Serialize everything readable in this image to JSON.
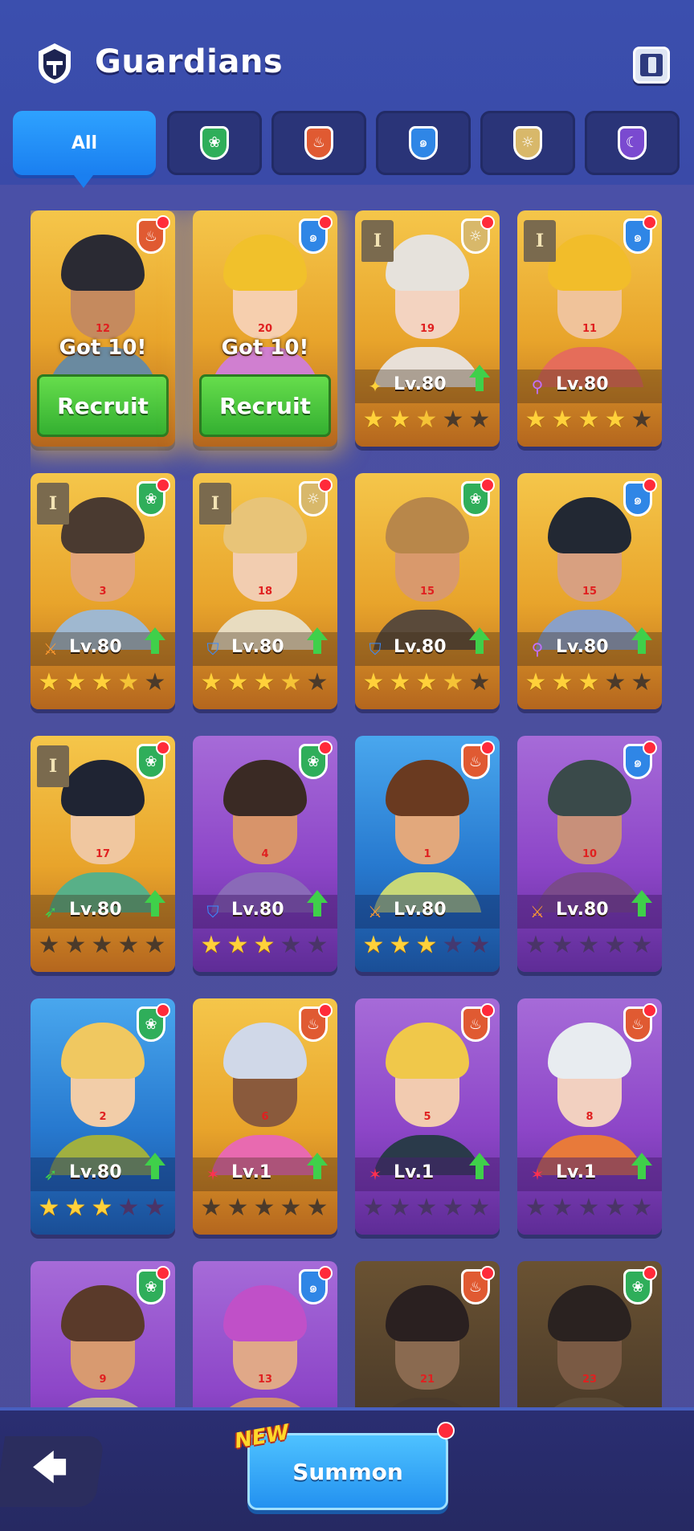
{
  "header": {
    "title": "Guardians"
  },
  "tabs": [
    {
      "label": "All",
      "active": true
    },
    {
      "icon": "leaf-shield-icon",
      "color": "#2fae5a"
    },
    {
      "icon": "flame-shield-icon",
      "color": "#e05a32"
    },
    {
      "icon": "water-shield-icon",
      "color": "#2f86e6"
    },
    {
      "icon": "sun-shield-icon",
      "color": "#d8b86a"
    },
    {
      "icon": "moon-shield-icon",
      "color": "#7a4ad0"
    }
  ],
  "cards": [
    {
      "num": "12",
      "bg": "gold",
      "element": "flame",
      "got": "Got 10!",
      "recruit": "Recruit",
      "glow": true,
      "skin": "#c58a5e",
      "hair": "#2a2a33",
      "cloth": "#6a8aa0"
    },
    {
      "num": "20",
      "bg": "gold",
      "element": "water",
      "got": "Got 10!",
      "recruit": "Recruit",
      "glow": true,
      "skin": "#f6cfae",
      "hair": "#f1c12b",
      "cloth": "#d07fd0"
    },
    {
      "num": "19",
      "bg": "gold",
      "element": "sun",
      "tower": "I",
      "level": "Lv.80",
      "role": "wing",
      "up": true,
      "stars": [
        1,
        1,
        0.5,
        0,
        0
      ],
      "skin": "#f3d3c0",
      "hair": "#e6e2dc",
      "cloth": "#e8e0d8"
    },
    {
      "num": "11",
      "bg": "gold",
      "element": "water",
      "tower": "I",
      "level": "Lv.80",
      "role": "staff",
      "stars": [
        1,
        1,
        1,
        1,
        0
      ],
      "skin": "#f0c39a",
      "hair": "#f2bd2a",
      "cloth": "#e56d5a"
    },
    {
      "num": "3",
      "bg": "gold",
      "element": "leaf",
      "tower": "I",
      "level": "Lv.80",
      "role": "sword",
      "up": true,
      "stars": [
        1,
        1,
        1,
        0.5,
        0
      ],
      "skin": "#e3a57a",
      "hair": "#4a3a30",
      "cloth": "#9fb8d0"
    },
    {
      "num": "18",
      "bg": "gold",
      "element": "sun",
      "tower": "I",
      "level": "Lv.80",
      "role": "shield",
      "up": true,
      "stars": [
        1,
        1,
        1,
        0.5,
        0
      ],
      "skin": "#f2cdb0",
      "hair": "#e8c478",
      "cloth": "#e8dcc0"
    },
    {
      "num": "15",
      "bg": "gold",
      "element": "leaf",
      "level": "Lv.80",
      "role": "shield",
      "up": true,
      "stars": [
        1,
        1,
        1,
        0.5,
        0
      ],
      "skin": "#d9996c",
      "hair": "#b8874a",
      "cloth": "#5a4a3a"
    },
    {
      "num": "15",
      "bg": "gold",
      "element": "water",
      "level": "Lv.80",
      "role": "staff",
      "up": true,
      "stars": [
        1,
        1,
        1,
        0,
        0
      ],
      "skin": "#d8a080",
      "hair": "#222833",
      "cloth": "#8aa0c8"
    },
    {
      "num": "17",
      "bg": "gold",
      "element": "leaf",
      "tower": "I",
      "level": "Lv.80",
      "role": "bow",
      "up": true,
      "stars": [
        0,
        0,
        0,
        0,
        0
      ],
      "skin": "#f0c7a0",
      "hair": "#1f2433",
      "cloth": "#58b088"
    },
    {
      "num": "4",
      "bg": "purple",
      "element": "leaf",
      "level": "Lv.80",
      "role": "shield",
      "up": true,
      "stars": [
        1,
        1,
        1,
        0,
        0
      ],
      "skin": "#d8946a",
      "hair": "#3a2a24",
      "cloth": "#8a6ab8"
    },
    {
      "num": "1",
      "bg": "blue",
      "element": "flame",
      "level": "Lv.80",
      "role": "sword",
      "stars": [
        1,
        1,
        1,
        0.5,
        0
      ],
      "skin": "#e2a87c",
      "hair": "#6a3a20",
      "cloth": "#c8d878"
    },
    {
      "num": "10",
      "bg": "purple",
      "element": "water",
      "level": "Lv.80",
      "role": "sword",
      "up": true,
      "stars": [
        0,
        0,
        0,
        0,
        0
      ],
      "skin": "#c8907a",
      "hair": "#3a4a4a",
      "cloth": "#7a4a8a"
    },
    {
      "num": "2",
      "bg": "blue",
      "element": "leaf",
      "level": "Lv.80",
      "role": "bow",
      "up": true,
      "stars": [
        1,
        1,
        1,
        0,
        0
      ],
      "skin": "#f2cda8",
      "hair": "#f0c860",
      "cloth": "#a0b040"
    },
    {
      "num": "6",
      "bg": "gold",
      "element": "flame",
      "level": "Lv.1",
      "role": "shuriken",
      "up": true,
      "stars": [
        0,
        0,
        0,
        0,
        0
      ],
      "skin": "#8a5a3c",
      "hair": "#d0d8e8",
      "cloth": "#e86ab0"
    },
    {
      "num": "5",
      "bg": "purple",
      "element": "flame",
      "level": "Lv.1",
      "role": "shuriken",
      "up": true,
      "stars": [
        0,
        0,
        0,
        0,
        0
      ],
      "skin": "#f2cbb0",
      "hair": "#f0c84a",
      "cloth": "#2a3a4a"
    },
    {
      "num": "8",
      "bg": "purple",
      "element": "flame",
      "level": "Lv.1",
      "role": "shuriken",
      "up": true,
      "stars": [
        0,
        0,
        0,
        0,
        0
      ],
      "skin": "#f2d0c0",
      "hair": "#e8ecf0",
      "cloth": "#e87a3a"
    },
    {
      "num": "9",
      "bg": "purple",
      "element": "leaf",
      "skin": "#d89a70",
      "hair": "#5a3a2a",
      "cloth": "#c8b090"
    },
    {
      "num": "13",
      "bg": "purple",
      "element": "water",
      "skin": "#e0a888",
      "hair": "#c050c8",
      "cloth": "#d09070"
    },
    {
      "num": "21",
      "bg": "dark",
      "element": "flame",
      "skin": "#8a6a50",
      "hair": "#2a2020",
      "cloth": "#4a3a2a"
    },
    {
      "num": "23",
      "bg": "dark",
      "element": "leaf",
      "skin": "#7a5a44",
      "hair": "#2a2220",
      "cloth": "#5a4a36"
    }
  ],
  "footer": {
    "new_tag": "NEW",
    "summon_label": "Summon"
  }
}
